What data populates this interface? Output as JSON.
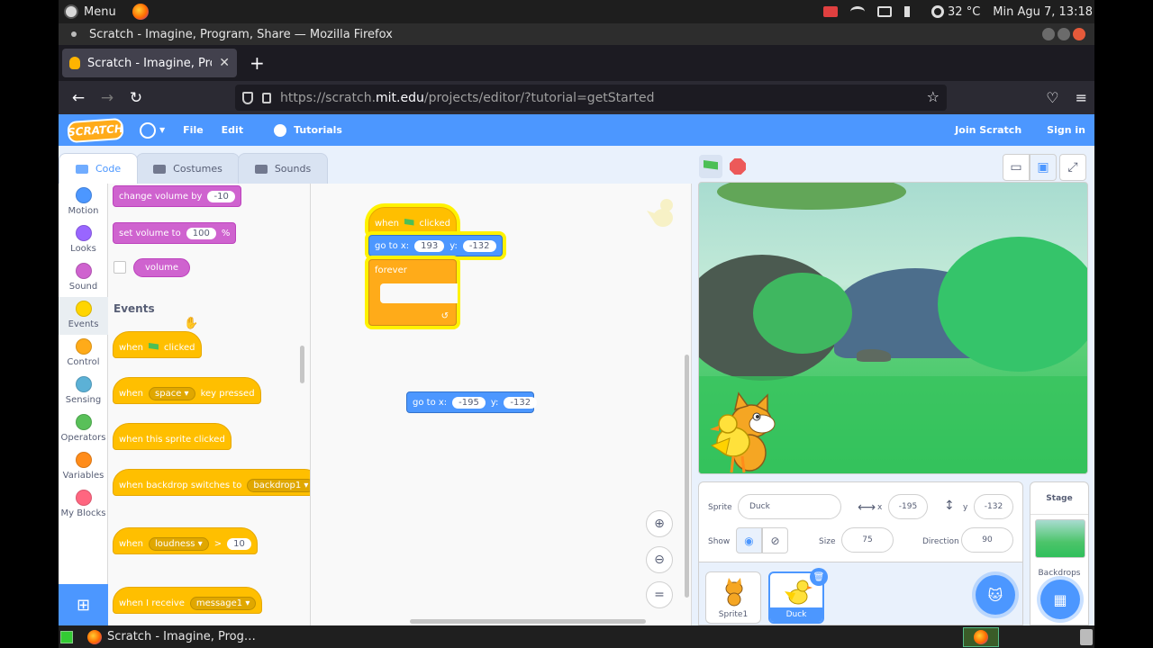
{
  "os": {
    "menu_label": "Menu",
    "temperature": "32 °C",
    "datetime": "Min Agu  7, 13:18"
  },
  "window": {
    "title": "Scratch - Imagine, Program, Share — Mozilla Firefox"
  },
  "browser": {
    "tab_title": "Scratch - Imagine, Program, Share",
    "url_prefix": "https://scratch.",
    "url_host": "mit.edu",
    "url_path": "/projects/editor/?tutorial=getStarted"
  },
  "scratch_header": {
    "logo_text": "SCRATCH",
    "file": "File",
    "edit": "Edit",
    "tutorials": "Tutorials",
    "join": "Join Scratch",
    "signin": "Sign in"
  },
  "editor_tabs": [
    "Code",
    "Costumes",
    "Sounds"
  ],
  "categories": [
    {
      "label": "Motion",
      "color": "#4c97ff"
    },
    {
      "label": "Looks",
      "color": "#9966ff"
    },
    {
      "label": "Sound",
      "color": "#cf63cf"
    },
    {
      "label": "Events",
      "color": "#ffd500"
    },
    {
      "label": "Control",
      "color": "#ffab19"
    },
    {
      "label": "Sensing",
      "color": "#5cb1d6"
    },
    {
      "label": "Operators",
      "color": "#59c059"
    },
    {
      "label": "Variables",
      "color": "#ff8c1a"
    },
    {
      "label": "My Blocks",
      "color": "#ff6680"
    }
  ],
  "palette": {
    "change_volume": "change volume by",
    "change_volume_val": "-10",
    "set_volume": "set volume to",
    "set_volume_val": "100",
    "set_volume_unit": "%",
    "volume_reporter": "volume",
    "events_heading": "Events",
    "when": "when",
    "clicked": "clicked",
    "key_pressed": "key pressed",
    "space": "space",
    "sprite_clicked": "when this sprite clicked",
    "backdrop_switches": "when backdrop switches to",
    "backdrop1": "backdrop1",
    "loudness": "loudness",
    "gt": ">",
    "loudness_val": "10",
    "i_receive": "when I receive",
    "message1": "message1"
  },
  "scripts": {
    "when": "when",
    "clicked": "clicked",
    "go_to_x": "go to x:",
    "y": "y:",
    "x1": "193",
    "y1": "-132",
    "forever": "forever",
    "x2": "-195",
    "y2": "-132"
  },
  "sprite_info": {
    "sprite_label": "Sprite",
    "sprite_name": "Duck",
    "x_label": "x",
    "x_val": "-195",
    "y_label": "y",
    "y_val": "-132",
    "show_label": "Show",
    "size_label": "Size",
    "size_val": "75",
    "direction_label": "Direction",
    "direction_val": "90"
  },
  "sprites": [
    "Sprite1",
    "Duck"
  ],
  "stage_panel": {
    "title": "Stage",
    "backdrops": "Backdrops"
  },
  "taskbar": {
    "task_label": "Scratch - Imagine, Prog…"
  }
}
